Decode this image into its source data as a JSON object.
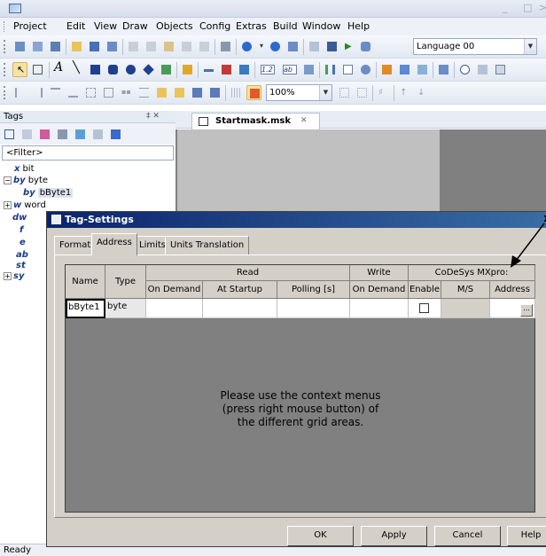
{
  "menubar": {
    "items": [
      "Project",
      "Edit",
      "View",
      "Draw",
      "Objects",
      "Config",
      "Extras",
      "Build",
      "Window",
      "Help"
    ]
  },
  "toolbar": {
    "language": "Language 00",
    "zoom": "100%",
    "format_value": "1.2",
    "text_value": "ab"
  },
  "tags_panel": {
    "title": "Tags",
    "pin": "‡ ✕",
    "filter": "<Filter>",
    "tree": [
      {
        "prefix": "x",
        "label": "bit"
      },
      {
        "prefix": "by",
        "label": "byte"
      },
      {
        "prefix": "by",
        "label": "bByte1"
      },
      {
        "prefix": "w",
        "label": "word"
      },
      {
        "prefix": "dw",
        "label": ""
      },
      {
        "prefix": "f",
        "label": ""
      },
      {
        "prefix": "e",
        "label": ""
      },
      {
        "prefix": "ab",
        "label": ""
      },
      {
        "prefix": "st",
        "label": ""
      },
      {
        "prefix": "sy",
        "label": ""
      }
    ]
  },
  "editor": {
    "tab": "Startmask.msk",
    "tab_close": "✕"
  },
  "status": "Ready",
  "dialog": {
    "title": "Tag-Settings",
    "close": "x",
    "tabs": [
      "Format",
      "Address",
      "Limits",
      "Units Translation"
    ],
    "active_tab": "Address",
    "grid": {
      "col_name": "Name",
      "col_type": "Type",
      "group_read": "Read",
      "group_write": "Write",
      "group_codesys": "CoDeSys MXpro:",
      "read_on_demand": "On Demand",
      "read_at_startup": "At Startup",
      "read_polling": "Polling [s]",
      "write_on_demand": "On Demand",
      "cds_enable": "Enable",
      "cds_ms": "M/S",
      "cds_address": "Address",
      "row": {
        "name": "bByte1",
        "type": "byte",
        "enable": false,
        "ellipsis": "..."
      }
    },
    "message_lines": [
      "Please use the context menus",
      "(press right mouse button) of",
      "the different grid areas."
    ],
    "buttons": {
      "ok": "OK",
      "apply": "Apply",
      "cancel": "Cancel",
      "help": "Help"
    }
  },
  "colors": {
    "dialog_face": "#d4d0c8",
    "title_gradient_start": "#0a246a",
    "title_gradient_end": "#3a6ea5",
    "editor_bg": "#808080"
  }
}
